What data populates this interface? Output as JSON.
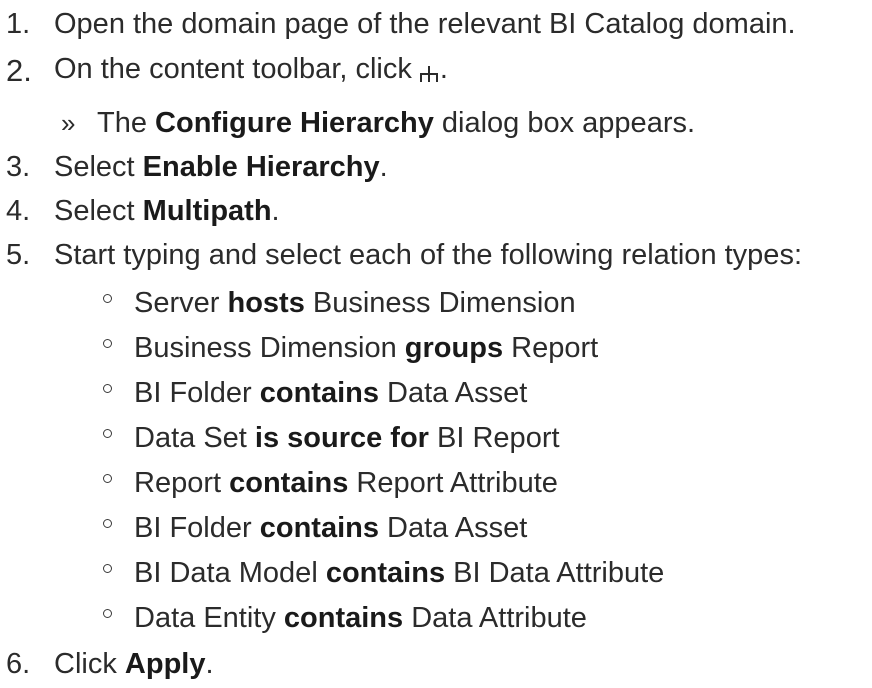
{
  "steps": [
    {
      "num": "1.",
      "text": "Open the domain page of the relevant BI Catalog domain."
    },
    {
      "num": "2.",
      "before": "On the content toolbar, click",
      "icon": "hierarchy-icon",
      "after": "."
    },
    {
      "result_marker": "»",
      "before": "The",
      "bold": "Configure Hierarchy",
      "after": "dialog box appears."
    },
    {
      "num": "3.",
      "before": "Select",
      "bold": "Enable Hierarchy",
      "after": "."
    },
    {
      "num": "4.",
      "before": "Select",
      "bold": "Multipath",
      "after": "."
    },
    {
      "num": "5.",
      "text": "Start typing and select each of the following relation types:"
    },
    {
      "num": "6.",
      "before": "Click",
      "bold": "Apply",
      "after": "."
    }
  ],
  "relation_types": [
    {
      "source": "Server",
      "relation": "hosts",
      "target": "Business Dimension"
    },
    {
      "source": "Business Dimension",
      "relation": "groups",
      "target": "Report"
    },
    {
      "source": "BI Folder",
      "relation": "contains",
      "target": "Data Asset"
    },
    {
      "source": "Data Set",
      "relation": "is source for",
      "target": "BI Report"
    },
    {
      "source": "Report",
      "relation": "contains",
      "target": "Report Attribute"
    },
    {
      "source": "BI Folder",
      "relation": "contains",
      "target": "Data Asset"
    },
    {
      "source": "BI Data Model",
      "relation": "contains",
      "target": "BI Data Attribute"
    },
    {
      "source": "Data Entity",
      "relation": "contains",
      "target": "Data Attribute"
    }
  ]
}
